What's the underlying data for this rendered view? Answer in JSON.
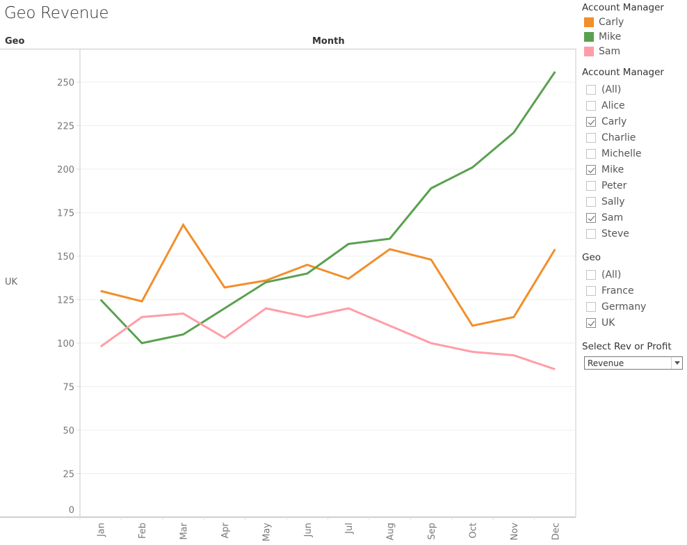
{
  "title": "Geo Revenue",
  "headers": {
    "row": "Geo",
    "column": "Month"
  },
  "row_label": "UK",
  "colors": {
    "Carly": "#f28e2b",
    "Mike": "#59a14f",
    "Sam": "#ff9da7"
  },
  "legend": {
    "title": "Account Manager",
    "items": [
      {
        "label": "Carly",
        "color": "#f28e2b"
      },
      {
        "label": "Mike",
        "color": "#59a14f"
      },
      {
        "label": "Sam",
        "color": "#ff9da7"
      }
    ]
  },
  "filters": {
    "account_manager": {
      "title": "Account Manager",
      "items": [
        {
          "label": "(All)",
          "checked": false
        },
        {
          "label": "Alice",
          "checked": false
        },
        {
          "label": "Carly",
          "checked": true
        },
        {
          "label": "Charlie",
          "checked": false
        },
        {
          "label": "Michelle",
          "checked": false
        },
        {
          "label": "Mike",
          "checked": true
        },
        {
          "label": "Peter",
          "checked": false
        },
        {
          "label": "Sally",
          "checked": false
        },
        {
          "label": "Sam",
          "checked": true
        },
        {
          "label": "Steve",
          "checked": false
        }
      ]
    },
    "geo": {
      "title": "Geo",
      "items": [
        {
          "label": "(All)",
          "checked": false
        },
        {
          "label": "France",
          "checked": false
        },
        {
          "label": "Germany",
          "checked": false
        },
        {
          "label": "UK",
          "checked": true
        }
      ]
    },
    "rev_or_profit": {
      "title": "Select Rev or Profit",
      "selected": "Revenue"
    }
  },
  "chart_data": {
    "type": "line",
    "title": "Geo Revenue",
    "xlabel": "Month",
    "ylabel": "",
    "row_dimension": "Geo",
    "row_value": "UK",
    "categories": [
      "Jan",
      "Feb",
      "Mar",
      "Apr",
      "May",
      "Jun",
      "Jul",
      "Aug",
      "Sep",
      "Oct",
      "Nov",
      "Dec"
    ],
    "ylim": [
      0,
      265
    ],
    "yticks": [
      0,
      25,
      50,
      75,
      100,
      125,
      150,
      175,
      200,
      225,
      250
    ],
    "grid": true,
    "legend_position": "top-right",
    "series": [
      {
        "name": "Carly",
        "color": "#f28e2b",
        "values": [
          130,
          124,
          168,
          132,
          136,
          145,
          137,
          154,
          148,
          110,
          115,
          154
        ]
      },
      {
        "name": "Mike",
        "color": "#59a14f",
        "values": [
          125,
          100,
          105,
          120,
          135,
          140,
          157,
          160,
          189,
          201,
          221,
          256
        ]
      },
      {
        "name": "Sam",
        "color": "#ff9da7",
        "values": [
          98,
          115,
          117,
          103,
          120,
          115,
          120,
          110,
          100,
          95,
          93,
          85
        ]
      }
    ]
  }
}
